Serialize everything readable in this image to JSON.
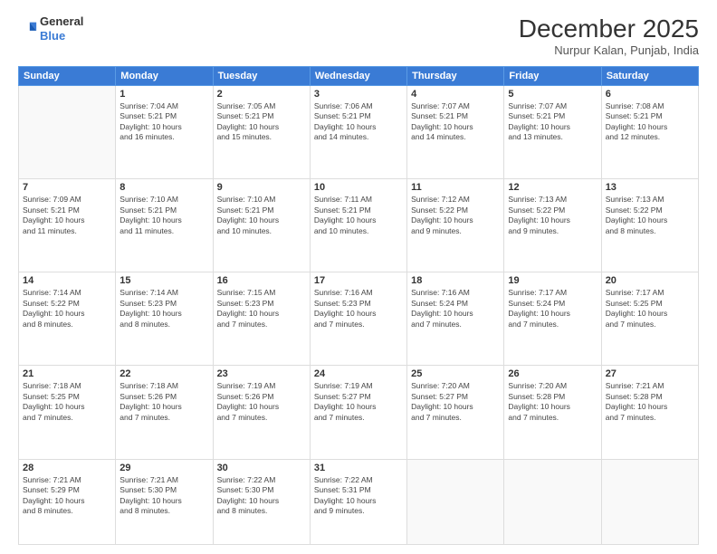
{
  "header": {
    "logo": {
      "line1": "General",
      "line2": "Blue"
    },
    "title": "December 2025",
    "location": "Nurpur Kalan, Punjab, India"
  },
  "weekdays": [
    "Sunday",
    "Monday",
    "Tuesday",
    "Wednesday",
    "Thursday",
    "Friday",
    "Saturday"
  ],
  "weeks": [
    [
      {
        "day": "",
        "info": ""
      },
      {
        "day": "1",
        "info": "Sunrise: 7:04 AM\nSunset: 5:21 PM\nDaylight: 10 hours\nand 16 minutes."
      },
      {
        "day": "2",
        "info": "Sunrise: 7:05 AM\nSunset: 5:21 PM\nDaylight: 10 hours\nand 15 minutes."
      },
      {
        "day": "3",
        "info": "Sunrise: 7:06 AM\nSunset: 5:21 PM\nDaylight: 10 hours\nand 14 minutes."
      },
      {
        "day": "4",
        "info": "Sunrise: 7:07 AM\nSunset: 5:21 PM\nDaylight: 10 hours\nand 14 minutes."
      },
      {
        "day": "5",
        "info": "Sunrise: 7:07 AM\nSunset: 5:21 PM\nDaylight: 10 hours\nand 13 minutes."
      },
      {
        "day": "6",
        "info": "Sunrise: 7:08 AM\nSunset: 5:21 PM\nDaylight: 10 hours\nand 12 minutes."
      }
    ],
    [
      {
        "day": "7",
        "info": "Sunrise: 7:09 AM\nSunset: 5:21 PM\nDaylight: 10 hours\nand 11 minutes."
      },
      {
        "day": "8",
        "info": "Sunrise: 7:10 AM\nSunset: 5:21 PM\nDaylight: 10 hours\nand 11 minutes."
      },
      {
        "day": "9",
        "info": "Sunrise: 7:10 AM\nSunset: 5:21 PM\nDaylight: 10 hours\nand 10 minutes."
      },
      {
        "day": "10",
        "info": "Sunrise: 7:11 AM\nSunset: 5:21 PM\nDaylight: 10 hours\nand 10 minutes."
      },
      {
        "day": "11",
        "info": "Sunrise: 7:12 AM\nSunset: 5:22 PM\nDaylight: 10 hours\nand 9 minutes."
      },
      {
        "day": "12",
        "info": "Sunrise: 7:13 AM\nSunset: 5:22 PM\nDaylight: 10 hours\nand 9 minutes."
      },
      {
        "day": "13",
        "info": "Sunrise: 7:13 AM\nSunset: 5:22 PM\nDaylight: 10 hours\nand 8 minutes."
      }
    ],
    [
      {
        "day": "14",
        "info": "Sunrise: 7:14 AM\nSunset: 5:22 PM\nDaylight: 10 hours\nand 8 minutes."
      },
      {
        "day": "15",
        "info": "Sunrise: 7:14 AM\nSunset: 5:23 PM\nDaylight: 10 hours\nand 8 minutes."
      },
      {
        "day": "16",
        "info": "Sunrise: 7:15 AM\nSunset: 5:23 PM\nDaylight: 10 hours\nand 7 minutes."
      },
      {
        "day": "17",
        "info": "Sunrise: 7:16 AM\nSunset: 5:23 PM\nDaylight: 10 hours\nand 7 minutes."
      },
      {
        "day": "18",
        "info": "Sunrise: 7:16 AM\nSunset: 5:24 PM\nDaylight: 10 hours\nand 7 minutes."
      },
      {
        "day": "19",
        "info": "Sunrise: 7:17 AM\nSunset: 5:24 PM\nDaylight: 10 hours\nand 7 minutes."
      },
      {
        "day": "20",
        "info": "Sunrise: 7:17 AM\nSunset: 5:25 PM\nDaylight: 10 hours\nand 7 minutes."
      }
    ],
    [
      {
        "day": "21",
        "info": "Sunrise: 7:18 AM\nSunset: 5:25 PM\nDaylight: 10 hours\nand 7 minutes."
      },
      {
        "day": "22",
        "info": "Sunrise: 7:18 AM\nSunset: 5:26 PM\nDaylight: 10 hours\nand 7 minutes."
      },
      {
        "day": "23",
        "info": "Sunrise: 7:19 AM\nSunset: 5:26 PM\nDaylight: 10 hours\nand 7 minutes."
      },
      {
        "day": "24",
        "info": "Sunrise: 7:19 AM\nSunset: 5:27 PM\nDaylight: 10 hours\nand 7 minutes."
      },
      {
        "day": "25",
        "info": "Sunrise: 7:20 AM\nSunset: 5:27 PM\nDaylight: 10 hours\nand 7 minutes."
      },
      {
        "day": "26",
        "info": "Sunrise: 7:20 AM\nSunset: 5:28 PM\nDaylight: 10 hours\nand 7 minutes."
      },
      {
        "day": "27",
        "info": "Sunrise: 7:21 AM\nSunset: 5:28 PM\nDaylight: 10 hours\nand 7 minutes."
      }
    ],
    [
      {
        "day": "28",
        "info": "Sunrise: 7:21 AM\nSunset: 5:29 PM\nDaylight: 10 hours\nand 8 minutes."
      },
      {
        "day": "29",
        "info": "Sunrise: 7:21 AM\nSunset: 5:30 PM\nDaylight: 10 hours\nand 8 minutes."
      },
      {
        "day": "30",
        "info": "Sunrise: 7:22 AM\nSunset: 5:30 PM\nDaylight: 10 hours\nand 8 minutes."
      },
      {
        "day": "31",
        "info": "Sunrise: 7:22 AM\nSunset: 5:31 PM\nDaylight: 10 hours\nand 9 minutes."
      },
      {
        "day": "",
        "info": ""
      },
      {
        "day": "",
        "info": ""
      },
      {
        "day": "",
        "info": ""
      }
    ]
  ]
}
